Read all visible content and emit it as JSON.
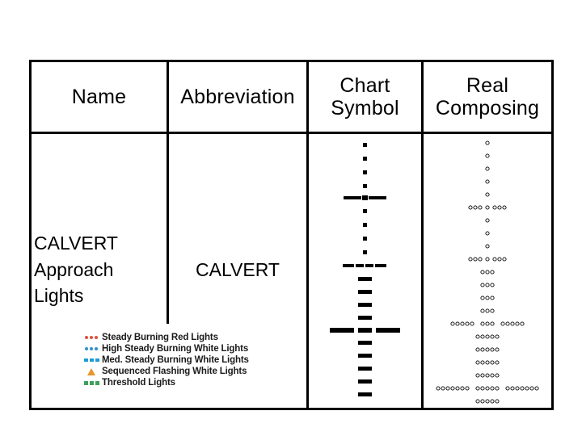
{
  "table": {
    "headers": [
      {
        "label": "Name"
      },
      {
        "label": "Abbreviation"
      },
      {
        "label_line1": "Chart",
        "label_line2": "Symbol"
      },
      {
        "label_line1": "Real",
        "label_line2": "Composing"
      }
    ],
    "rows": [
      {
        "name_line1": "CALVERT",
        "name_line2": "Approach",
        "name_line3": "Lights",
        "abbreviation": "CALVERT",
        "chart_symbol": "calvert-approach-light-centerline-with-crossbars",
        "real_composing": "calvert-approach-light-real-lamp-layout"
      }
    ]
  },
  "legend": {
    "items": [
      {
        "label": "Steady Burning Red Lights",
        "marker": "three-dots",
        "color": "#e0513b"
      },
      {
        "label": "High Steady Burning White Lights",
        "marker": "three-dots",
        "color": "#2f8fd0"
      },
      {
        "label": "Med. Steady Burning White Lights",
        "marker": "three-dashes",
        "color": "#1f9bd6"
      },
      {
        "label": "Sequenced Flashing White Lights",
        "marker": "triangle",
        "color": "#e8962e"
      },
      {
        "label": "Threshold Lights",
        "marker": "three-squares",
        "color": "#3fa05a"
      }
    ]
  },
  "colors": {
    "border": "#000000",
    "background": "#ffffff",
    "text": "#000000"
  }
}
